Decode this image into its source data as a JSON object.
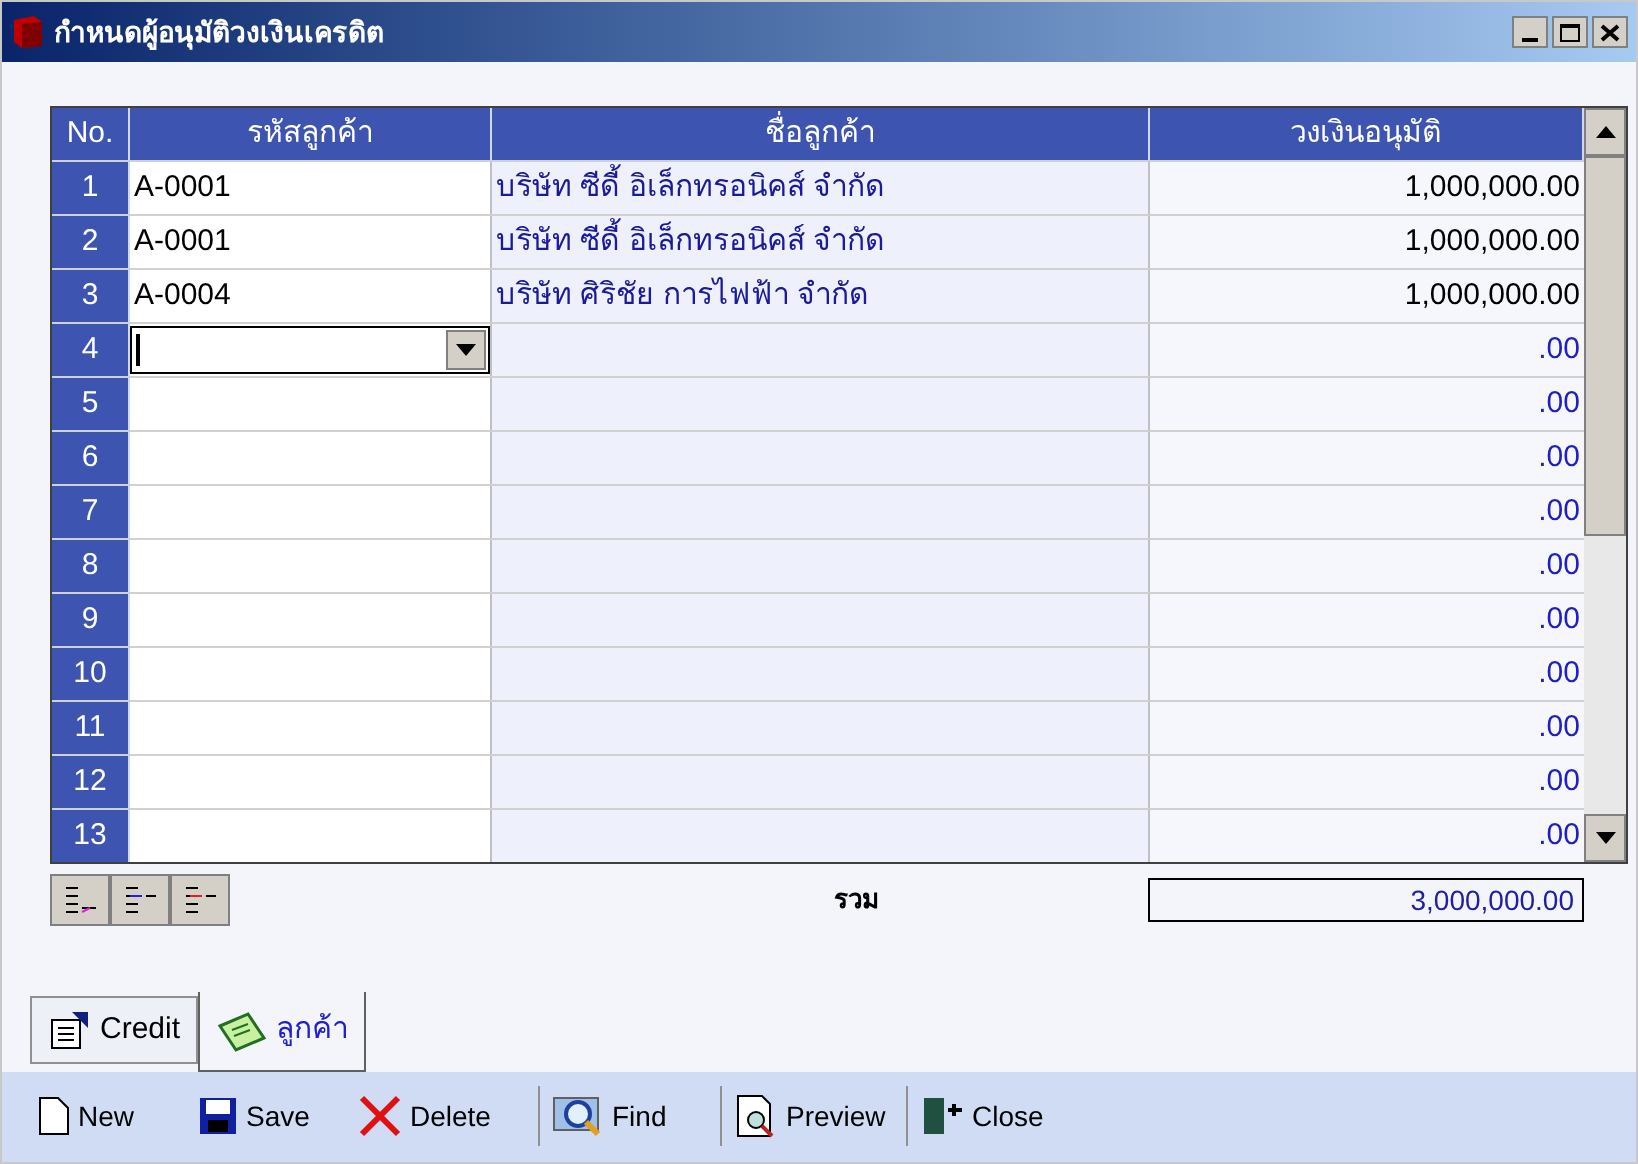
{
  "window": {
    "title": "กำหนดผู้อนุมัติวงเงินเครดิต"
  },
  "table": {
    "columns": [
      "No.",
      "รหัสลูกค้า",
      "ชื่อลูกค้า",
      "วงเงินอนุมัติ"
    ],
    "rows": [
      {
        "no": "1",
        "code": "A-0001",
        "name": "บริษัท ซีดี้ อิเล็กทรอนิคส์ จำกัด",
        "amount": "1,000,000.00",
        "editing": false
      },
      {
        "no": "2",
        "code": "A-0001",
        "name": "บริษัท ซีดี้ อิเล็กทรอนิคส์ จำกัด",
        "amount": "1,000,000.00",
        "editing": false
      },
      {
        "no": "3",
        "code": "A-0004",
        "name": "บริษัท ศิริชัย การไฟฟ้า จำกัด",
        "amount": "1,000,000.00",
        "editing": false
      },
      {
        "no": "4",
        "amount": ".00",
        "editing": true
      },
      {
        "no": "5",
        "amount": ".00",
        "editing": false
      },
      {
        "no": "6",
        "amount": ".00",
        "editing": false
      },
      {
        "no": "7",
        "amount": ".00",
        "editing": false
      },
      {
        "no": "8",
        "amount": ".00",
        "editing": false
      },
      {
        "no": "9",
        "amount": ".00",
        "editing": false
      },
      {
        "no": "10",
        "amount": ".00",
        "editing": false
      },
      {
        "no": "11",
        "amount": ".00",
        "editing": false
      },
      {
        "no": "12",
        "amount": ".00",
        "editing": false
      },
      {
        "no": "13",
        "amount": ".00",
        "editing": false
      }
    ]
  },
  "total": {
    "label": "รวม",
    "value": "3,000,000.00"
  },
  "tabs": [
    {
      "label": "Credit",
      "selected": false
    },
    {
      "label": "ลูกค้า",
      "selected": true
    }
  ],
  "toolbar": [
    "New",
    "Save",
    "Delete",
    "Find",
    "Preview",
    "Close"
  ]
}
